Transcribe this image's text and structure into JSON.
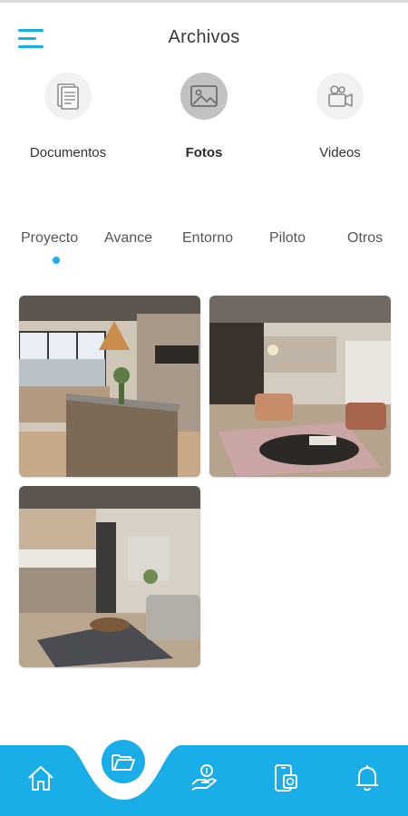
{
  "header": {
    "title": "Archivos"
  },
  "categories": [
    {
      "label": "Documentos",
      "icon": "document-icon"
    },
    {
      "label": "Fotos",
      "icon": "image-icon",
      "active": true
    },
    {
      "label": "Videos",
      "icon": "video-camera-icon"
    }
  ],
  "tabs": [
    {
      "label": "Proyecto",
      "active": true
    },
    {
      "label": "Avance"
    },
    {
      "label": "Entorno"
    },
    {
      "label": "Piloto"
    },
    {
      "label": "Otros"
    }
  ],
  "photos": [
    {
      "name": "kitchen-island-photo"
    },
    {
      "name": "living-room-photo"
    },
    {
      "name": "open-plan-kitchen-photo"
    }
  ],
  "bottom_nav": [
    {
      "icon": "home-icon"
    },
    {
      "icon": "folder-icon",
      "active": true
    },
    {
      "icon": "hand-coin-icon"
    },
    {
      "icon": "phone-document-icon"
    },
    {
      "icon": "bell-icon"
    }
  ],
  "colors": {
    "accent": "#1aaee8",
    "active_circle": "#c2c2c2",
    "inactive_circle": "#f1f1f1"
  }
}
